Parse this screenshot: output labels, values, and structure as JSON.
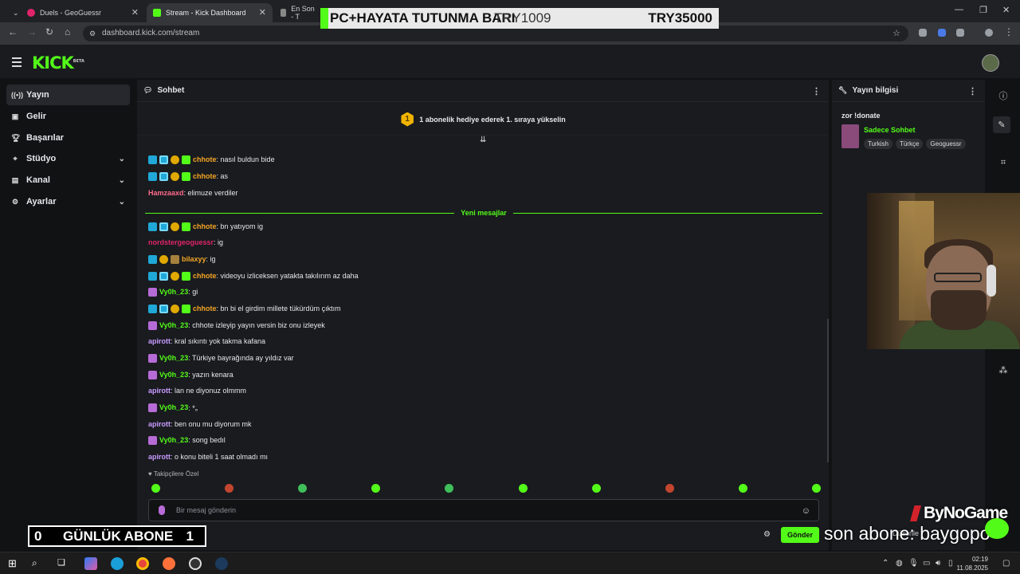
{
  "browser": {
    "tabs": [
      {
        "title": "Duels - GeoGuessr"
      },
      {
        "title": "Stream - Kick Dashboard"
      },
      {
        "title": "En Son - T"
      }
    ],
    "url": "dashboard.kick.com/stream"
  },
  "banner": {
    "text": "PC+HAYATA TUTUNMA BARI",
    "current": "TRY1009",
    "goal": "TRY35000"
  },
  "header": {
    "logo": "KICK",
    "logo_sup": "BETA"
  },
  "sidebar": {
    "items": [
      {
        "label": "Yayın",
        "icon": "broadcast-icon"
      },
      {
        "label": "Gelir",
        "icon": "revenue-icon"
      },
      {
        "label": "Başarılar",
        "icon": "trophy-icon"
      },
      {
        "label": "Stüdyo",
        "icon": "studio-icon"
      },
      {
        "label": "Kanal",
        "icon": "channel-icon"
      },
      {
        "label": "Ayarlar",
        "icon": "gear-icon"
      }
    ]
  },
  "chat": {
    "title": "Sohbet",
    "pinned": "1 abonelik hediye ederek 1. sıraya yükselin",
    "pinned_rank": "1",
    "new_messages_label": "Yeni mesajlar",
    "messages": [
      {
        "user": "chhote",
        "text": ": nasıl buldun bide",
        "color": "#f5a524",
        "badges": [
          "bm",
          "bv",
          "bs",
          "bg"
        ]
      },
      {
        "user": "chhote",
        "text": ": as",
        "color": "#f5a524",
        "badges": [
          "bm",
          "bv",
          "bs",
          "bg"
        ]
      },
      {
        "user": "Hamzaaxd",
        "text": ": elimuze verdiler",
        "color": "#ff6b8a",
        "badges": []
      },
      {
        "user": "chhote",
        "text": ": bn yatıyom ig",
        "color": "#f5a524",
        "badges": [
          "bm",
          "bv",
          "bs",
          "bg"
        ]
      },
      {
        "user": "nordstergeoguessr",
        "text": ": ig",
        "color": "#e0246b",
        "badges": []
      },
      {
        "user": "bilaxyy",
        "text": ": ig",
        "color": "#f5a524",
        "badges": [
          "bm",
          "bs",
          "bk"
        ]
      },
      {
        "user": "chhote",
        "text": ": videoyu izliceksen yatakta takılırım az daha",
        "color": "#f5a524",
        "badges": [
          "bm",
          "bv",
          "bs",
          "bg"
        ]
      },
      {
        "user": "Vy0h_23",
        "text": ": gi",
        "color": "#53fc18",
        "badges": [
          "bp"
        ]
      },
      {
        "user": "chhote",
        "text": ": bn bi el girdim millete tükürdüm çıktım",
        "color": "#f5a524",
        "badges": [
          "bm",
          "bv",
          "bs",
          "bg"
        ]
      },
      {
        "user": "Vy0h_23",
        "text": ": chhote izleyip yayın versin biz onu izleyek",
        "color": "#53fc18",
        "badges": [
          "bp"
        ]
      },
      {
        "user": "apirott",
        "text": ": kral sıkıntı yok takma kafana",
        "color": "#c89bff",
        "badges": []
      },
      {
        "user": "Vy0h_23",
        "text": ": Türkiye bayrağında ay yıldız var",
        "color": "#53fc18",
        "badges": [
          "bp"
        ]
      },
      {
        "user": "Vy0h_23",
        "text": ": yazın kenara",
        "color": "#53fc18",
        "badges": [
          "bp"
        ]
      },
      {
        "user": "apirott",
        "text": ": lan ne diyonuz olmmm",
        "color": "#c89bff",
        "badges": []
      },
      {
        "user": "Vy0h_23",
        "text": ": *。",
        "color": "#53fc18",
        "badges": [
          "bp"
        ]
      },
      {
        "user": "apirott",
        "text": ": ben onu mu diyorum mk",
        "color": "#c89bff",
        "badges": []
      },
      {
        "user": "Vy0h_23",
        "text": ": song bedıl",
        "color": "#53fc18",
        "badges": [
          "bp"
        ]
      },
      {
        "user": "apirott",
        "text": ": o konu biteli 1 saat olmadı mı",
        "color": "#c89bff",
        "badges": []
      }
    ],
    "follower_emotes_label": "Takipçilere Özel",
    "input_placeholder": "Bir mesaj gönderin",
    "send_label": "Gönder"
  },
  "stream_info": {
    "title": "Yayın bilgisi",
    "stream_title": "zor !donate",
    "mode": "Sadece Sohbet",
    "tags": [
      "Turkish",
      "Türkçe",
      "Geoguessr"
    ]
  },
  "overlay": {
    "subs_today_label": "GÜNLÜK ABONE",
    "subs_today_count": "0",
    "subs_goal": "1",
    "last_sub": "son abone: baygopo",
    "sponsor": "ByNoGame",
    "edit_label": "Düzenle"
  },
  "taskbar": {
    "time": "02:19",
    "date": "11.08.2025"
  }
}
